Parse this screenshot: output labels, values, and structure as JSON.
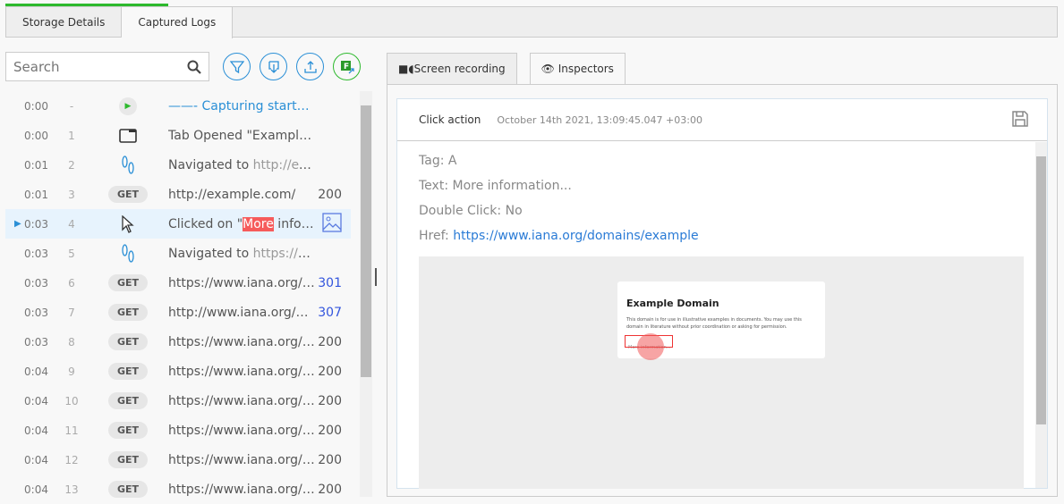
{
  "tabs": [
    {
      "label": "Storage Details"
    },
    {
      "label": "Captured Logs"
    }
  ],
  "search": {
    "placeholder": "Search"
  },
  "toolbar": {
    "filter": "filter-icon",
    "download": "download-icon",
    "upload": "upload-icon",
    "export": "export-f-icon"
  },
  "colors": {
    "accent": "#2a8fd6",
    "green": "#2db92d",
    "highlight": "#f65b5b"
  },
  "rows": [
    {
      "time": "0:00",
      "n": "-",
      "type": "play",
      "text": "——-  Capturing started  ——-",
      "status": ""
    },
    {
      "time": "0:00",
      "n": "1",
      "type": "tab",
      "text": "Tab Opened \"Example Domain\"",
      "status": ""
    },
    {
      "time": "0:01",
      "n": "2",
      "type": "nav",
      "text": "Navigated to ",
      "url": "http://example.com/",
      "status": ""
    },
    {
      "time": "0:01",
      "n": "3",
      "type": "get",
      "text": "http://example.com/",
      "status": "200"
    },
    {
      "time": "0:03",
      "n": "4",
      "type": "click",
      "pre": "Clicked on \"",
      "mark": "More",
      "post": " information...\"",
      "status": ""
    },
    {
      "time": "0:03",
      "n": "5",
      "type": "nav",
      "text": "Navigated to ",
      "url": "https://www.iana.org/domains/example",
      "status": ""
    },
    {
      "time": "0:03",
      "n": "6",
      "type": "get",
      "text": "https://www.iana.org/domains/example",
      "status": "301"
    },
    {
      "time": "0:03",
      "n": "7",
      "type": "get",
      "text": "http://www.iana.org/domains/example",
      "status": "307"
    },
    {
      "time": "0:03",
      "n": "8",
      "type": "get",
      "text": "https://www.iana.org/domains/reserved",
      "status": "200"
    },
    {
      "time": "0:04",
      "n": "9",
      "type": "get",
      "text": "https://www.iana.org/_css/style.css",
      "status": "200"
    },
    {
      "time": "0:04",
      "n": "10",
      "type": "get",
      "text": "https://www.iana.org/_js/jquery.js",
      "status": "200"
    },
    {
      "time": "0:04",
      "n": "11",
      "type": "get",
      "text": "https://www.iana.org/_js/iana.js",
      "status": "200"
    },
    {
      "time": "0:04",
      "n": "12",
      "type": "get",
      "text": "https://www.iana.org/_img/logo.svg",
      "status": "200"
    },
    {
      "time": "0:04",
      "n": "13",
      "type": "get",
      "text": "https://www.iana.org/_img/icons.svg",
      "status": "200"
    }
  ],
  "get_label": "GET",
  "right_tabs": [
    {
      "label": "Screen recording"
    },
    {
      "label": "Inspectors"
    }
  ],
  "inspector": {
    "title": "Click action",
    "date": "October 14th 2021, 13:09:45.047 +03:00",
    "tag_label": "Tag:",
    "tag": "A",
    "text_label": "Text:",
    "text": "More information...",
    "dbl_label": "Double Click:",
    "dbl": "No",
    "href_label": "Href:",
    "href": "https://www.iana.org/domains/example"
  },
  "screenshot": {
    "heading": "Example Domain",
    "para": "This domain is for use in illustrative examples in documents. You may use this domain in literature without prior coordination or asking for permission.",
    "link": "More information..."
  }
}
